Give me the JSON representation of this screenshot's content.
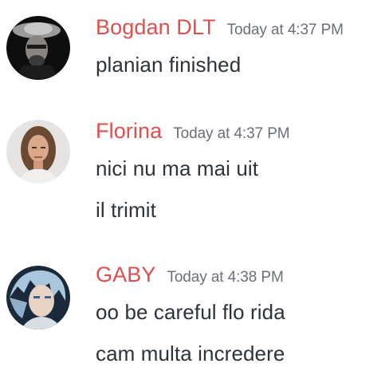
{
  "accent": {
    "username_color": "#e04e4e",
    "timestamp_color": "#6b7078",
    "text_color": "#2e3338"
  },
  "messages": [
    {
      "author": "Bogdan DLT",
      "timestamp": "Today at 4:37 PM",
      "avatar_icon": "user-avatar-bogdan",
      "lines": [
        "planian finished"
      ]
    },
    {
      "author": "Florina",
      "timestamp": "Today at 4:37 PM",
      "avatar_icon": "user-avatar-florina",
      "lines": [
        "nici nu ma mai uit",
        "il trimit"
      ]
    },
    {
      "author": "GABY",
      "timestamp": "Today at 4:38 PM",
      "avatar_icon": "user-avatar-gaby",
      "lines": [
        "oo be careful flo rida",
        "cam multa incredere"
      ]
    }
  ]
}
